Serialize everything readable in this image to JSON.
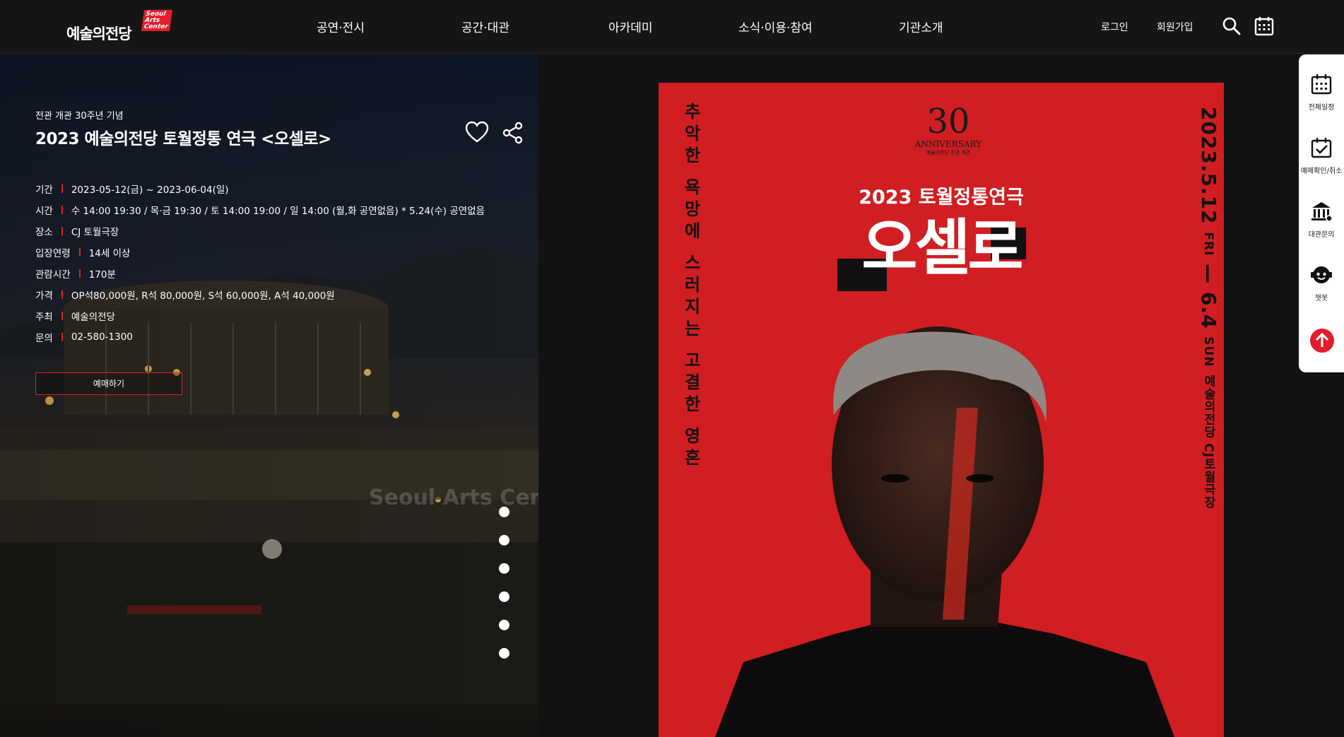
{
  "header": {
    "logo_text": "예술의전당",
    "logo_badge": [
      "Seoul",
      "Arts",
      "Center"
    ],
    "nav": [
      "공연·전시",
      "공간·대관",
      "아카데미",
      "소식·이용·참여",
      "기관소개"
    ],
    "login": "로그인",
    "signup": "회원가입",
    "icons": [
      "search-icon",
      "calendar-icon"
    ]
  },
  "hero": {
    "subtitle": "전관 개관 30주년 기념",
    "title": "2023 예술의전당 토월정통 연극 <오셀로>",
    "info": [
      {
        "label": "기간",
        "value": "2023-05-12(금) ~ 2023-06-04(일)"
      },
      {
        "label": "시간",
        "value": "수 14:00 19:30 / 목·금 19:30 / 토 14:00 19:00 / 일 14:00 (월,화 공연없음) * 5.24(수) 공연없음"
      },
      {
        "label": "장소",
        "value": "CJ 토월극장"
      },
      {
        "label": "입장연령",
        "value": "14세 이상"
      },
      {
        "label": "관람시간",
        "value": "170분"
      },
      {
        "label": "가격",
        "value": "OP석80,000원, R석 80,000원, S석 60,000원, A석 40,000원"
      },
      {
        "label": "주최",
        "value": "예술의전당"
      },
      {
        "label": "문의",
        "value": "02-580-1300"
      }
    ],
    "book_button": "예매하기",
    "watermark": "Seoul Arts Center",
    "slide_count": 6,
    "colors": {
      "accent": "#e21d2c"
    }
  },
  "poster": {
    "left_tagline": [
      "추",
      "악",
      "한",
      "",
      "욕",
      "망",
      "에",
      "",
      "스",
      "러",
      "지",
      "는",
      "",
      "고",
      "결",
      "한",
      "",
      "영",
      "혼"
    ],
    "date_main": "2023.5.12",
    "date_fri": "FRI",
    "date_dash": "—",
    "date_end": "6.4",
    "date_sun": "SUN",
    "venue": "예술의전당 CJ토월극장",
    "anniv_number": "30",
    "anniv_label": "ANNIVERSARY",
    "anniv_sub": "예술의전당 전관 개관",
    "subtitle": "2023 토월정통연극",
    "title": "오셀로",
    "background": "#d01e22"
  },
  "quick_menu": [
    {
      "label": "전체일정",
      "icon": "calendar-icon"
    },
    {
      "label": "예매확인/취소",
      "icon": "calendar-check-icon"
    },
    {
      "label": "대관문의",
      "icon": "building-icon"
    },
    {
      "label": "챗봇",
      "icon": "chatbot-icon"
    }
  ]
}
